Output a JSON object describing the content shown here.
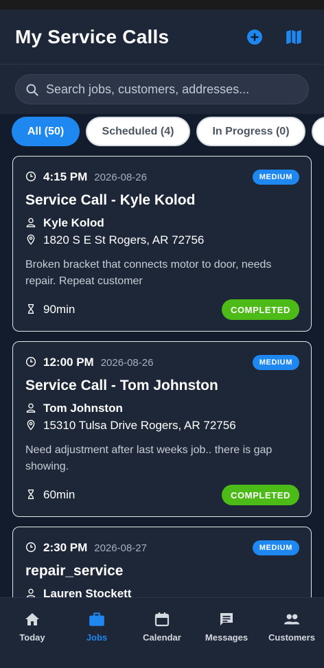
{
  "header": {
    "title": "My Service Calls",
    "add_icon": "add-circle-icon",
    "map_icon": "map-icon"
  },
  "search": {
    "placeholder": "Search jobs, customers, addresses...",
    "value": ""
  },
  "filters": [
    {
      "label": "All (50)",
      "active": true
    },
    {
      "label": "Scheduled (4)",
      "active": false
    },
    {
      "label": "In Progress (0)",
      "active": false
    }
  ],
  "jobs": [
    {
      "time": "4:15 PM",
      "date": "2026-08-26",
      "priority": "MEDIUM",
      "title": "Service Call - Kyle Kolod",
      "customer": "Kyle Kolod",
      "address": "1820 S E St Rogers, AR 72756",
      "description": "Broken bracket that connects motor to door, needs repair. Repeat customer",
      "duration": "90min",
      "status": "COMPLETED"
    },
    {
      "time": "12:00 PM",
      "date": "2026-08-26",
      "priority": "MEDIUM",
      "title": "Service Call - Tom Johnston",
      "customer": "Tom Johnston",
      "address": "15310 Tulsa Drive Rogers, AR 72756",
      "description": "Need adjustment after last weeks job.. there is gap showing.",
      "duration": "60min",
      "status": "COMPLETED"
    },
    {
      "time": "2:30 PM",
      "date": "2026-08-27",
      "priority": "MEDIUM",
      "title": "repair_service",
      "customer": "Lauren Stockett"
    }
  ],
  "tabs": [
    {
      "label": "Today",
      "icon": "home-icon",
      "active": false
    },
    {
      "label": "Jobs",
      "icon": "briefcase-icon",
      "active": true
    },
    {
      "label": "Calendar",
      "icon": "calendar-icon",
      "active": false
    },
    {
      "label": "Messages",
      "icon": "message-icon",
      "active": false
    },
    {
      "label": "Customers",
      "icon": "people-icon",
      "active": false
    }
  ],
  "colors": {
    "background": "#131c2d",
    "surface": "#1d2738",
    "accent": "#1e88f0",
    "completed": "#4cbb17"
  }
}
